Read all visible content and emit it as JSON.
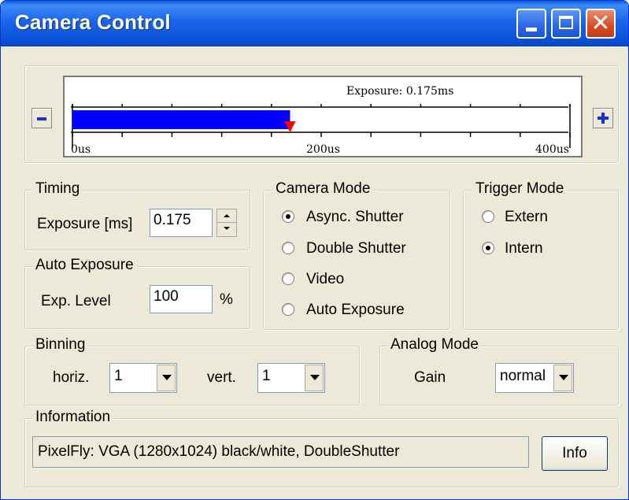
{
  "window": {
    "title": "Camera Control"
  },
  "exposure_bar": {
    "caption": "Exposure: 0.175ms",
    "axis_labels": [
      "0us",
      "200us",
      "400us"
    ],
    "value_fraction": 0.4375,
    "fill_color": "#0000ff",
    "marker_color": "#ff0000"
  },
  "timing": {
    "title": "Timing",
    "exposure_label": "Exposure [ms]",
    "exposure_value": "0.175"
  },
  "auto_exposure": {
    "title": "Auto Exposure",
    "level_label": "Exp. Level",
    "level_value": "100",
    "unit": "%"
  },
  "camera_mode": {
    "title": "Camera Mode",
    "options": [
      {
        "label": "Async. Shutter",
        "selected": true
      },
      {
        "label": "Double Shutter",
        "selected": false
      },
      {
        "label": "Video",
        "selected": false
      },
      {
        "label": "Auto Exposure",
        "selected": false
      }
    ]
  },
  "trigger_mode": {
    "title": "Trigger Mode",
    "options": [
      {
        "label": "Extern",
        "selected": false
      },
      {
        "label": "Intern",
        "selected": true
      }
    ]
  },
  "binning": {
    "title": "Binning",
    "horiz_label": "horiz.",
    "horiz_value": "1",
    "vert_label": "vert.",
    "vert_value": "1"
  },
  "analog_mode": {
    "title": "Analog Mode",
    "gain_label": "Gain",
    "gain_value": "normal"
  },
  "information": {
    "title": "Information",
    "text": "PixelFly: VGA (1280x1024) black/white, DoubleShutter",
    "info_button": "Info"
  }
}
